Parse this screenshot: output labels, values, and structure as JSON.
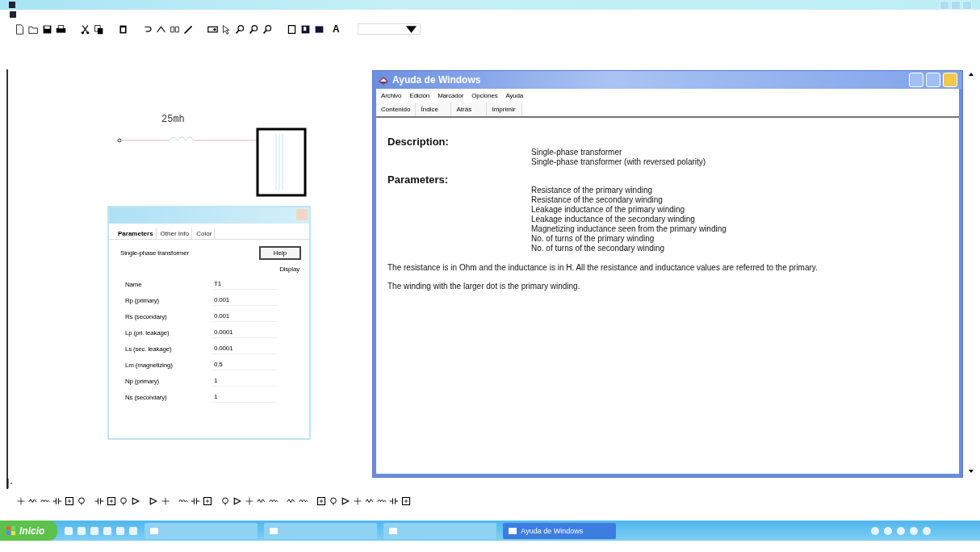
{
  "toolbar": {
    "text_tool": "A"
  },
  "schematic": {
    "inductor_label": "25mh"
  },
  "param_dialog": {
    "tabs": [
      {
        "label": "Parameters",
        "selected": true
      },
      {
        "label": "Other Info",
        "selected": false
      },
      {
        "label": "Color",
        "selected": false
      }
    ],
    "description": "Single-phase transformer",
    "help_button": "Help",
    "display_header": "Display",
    "rows": [
      {
        "name": "Name",
        "value": "T1"
      },
      {
        "name": "Rp (primary)",
        "value": "0.001"
      },
      {
        "name": "Rs (secondary)",
        "value": "0.001"
      },
      {
        "name": "Lp (pri. leakage)",
        "value": "0.0001"
      },
      {
        "name": "Ls (sec. leakage)",
        "value": "0.0001"
      },
      {
        "name": "Lm (magnetizing)",
        "value": "0.5"
      },
      {
        "name": "Np (primary)",
        "value": "1"
      },
      {
        "name": "Ns (secondary)",
        "value": "1"
      }
    ]
  },
  "help_window": {
    "title": "Ayuda de Windows",
    "menu": [
      "Archivo",
      "Edición",
      "Marcador",
      "Opciones",
      "Ayuda"
    ],
    "buttons": [
      "Contenido",
      "Índice",
      "Atrás",
      "Imprimir"
    ],
    "sections": [
      {
        "heading": "Description:",
        "items": [
          "Single-phase transformer",
          "Single-phase transformer (with reversed polarity)"
        ]
      },
      {
        "heading": "Parameters:",
        "items": [
          "Resistance of the primary winding",
          "Resistance of the secondary winding",
          "Leakage inductance of the primary winding",
          "Leakage inductance of the secondary winding",
          "Magnetizing inductance seen from the primary winding",
          "No. of turns of the primary winding",
          "No. of turns of the secondary winding"
        ]
      }
    ],
    "paragraphs": [
      "The resistance is in Ohm and the inductance is in H.  All the resistance and inductance values are referred to the primary.",
      "The winding with the larger dot is the primary winding."
    ]
  },
  "taskbar": {
    "start": "Inicio",
    "tasks": [
      {
        "selected": false
      },
      {
        "selected": false
      },
      {
        "selected": false
      },
      {
        "label": "Ayuda de Windows",
        "selected": true
      }
    ]
  }
}
